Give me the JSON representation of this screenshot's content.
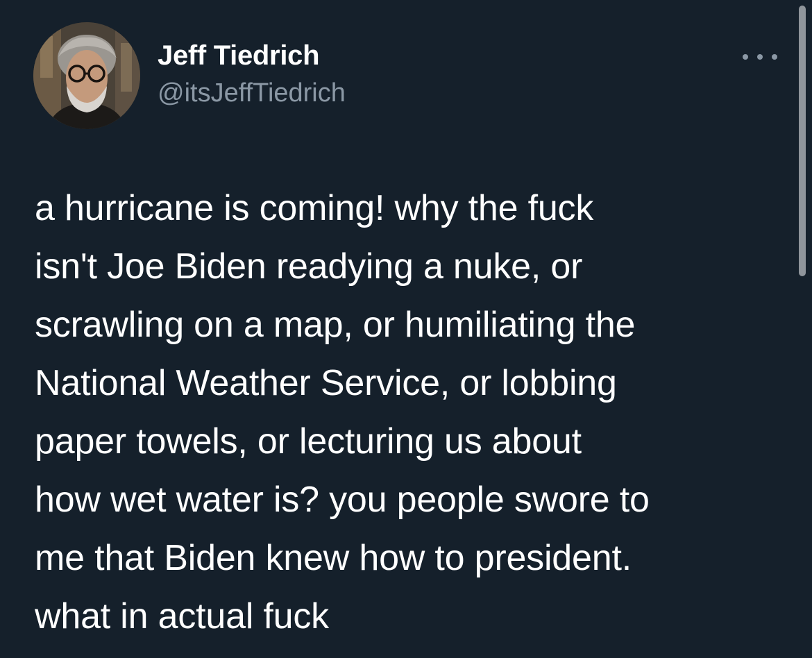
{
  "author": {
    "name": "Jeff Tiedrich",
    "handle": "@itsJeffTiedrich",
    "avatar_icon": "profile-photo"
  },
  "menu": {
    "icon": "more-options-icon"
  },
  "tweet": {
    "lines": [
      "a hurricane is coming! why the fuck",
      "isn't Joe Biden readying a nuke, or",
      "scrawling on a map, or humiliating the",
      "National Weather Service, or lobbing",
      "paper towels, or lecturing us about",
      "how wet water is? you people swore to",
      "me that Biden knew how to president.",
      "what in actual fuck"
    ]
  },
  "colors": {
    "background": "#15202b",
    "primary_text": "#ffffff",
    "secondary_text": "#8b98a5"
  }
}
